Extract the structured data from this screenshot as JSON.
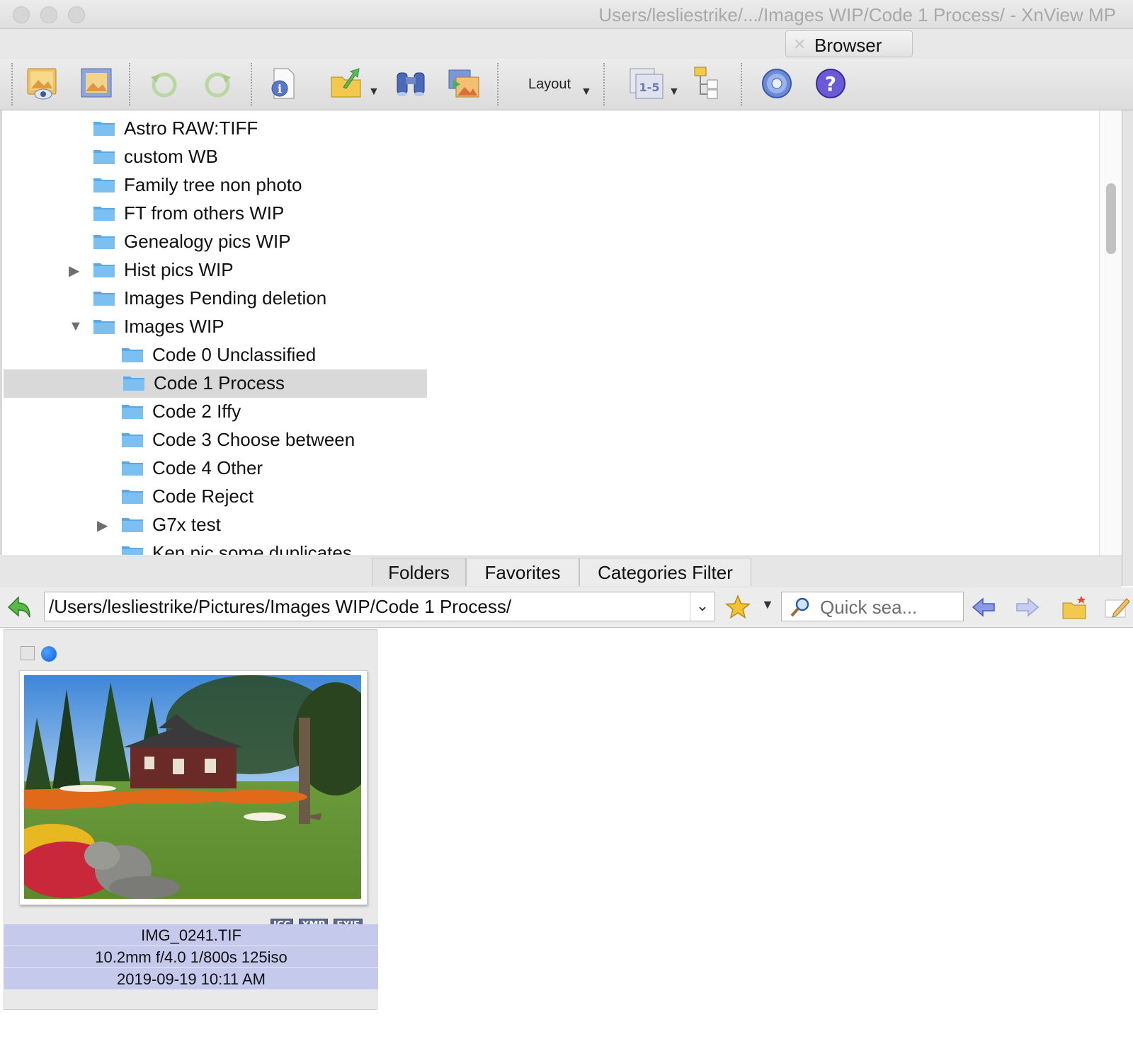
{
  "window": {
    "title": "Users/lesliestrike/.../Images WIP/Code 1 Process/ - XnView MP"
  },
  "tabs": {
    "browser_label": "Browser",
    "close_glyph": "✕"
  },
  "toolbar": {
    "layout_label": "Layout",
    "pages_label": "1-5",
    "icons": [
      "view-image-icon",
      "fullscreen-icon",
      "rotate-left-icon",
      "rotate-right-icon",
      "info-icon",
      "export-icon",
      "search-binoculars-icon",
      "convert-icon",
      "layout-dropdown",
      "batch-rename-icon",
      "compare-icon",
      "settings-gear-icon",
      "help-icon"
    ]
  },
  "tree": {
    "items": [
      {
        "label": "Astro RAW:TIFF",
        "level": 1,
        "expander": ""
      },
      {
        "label": "custom WB",
        "level": 1,
        "expander": ""
      },
      {
        "label": "Family tree non photo",
        "level": 1,
        "expander": ""
      },
      {
        "label": "FT from others WIP",
        "level": 1,
        "expander": ""
      },
      {
        "label": "Genealogy pics WIP",
        "level": 1,
        "expander": ""
      },
      {
        "label": "Hist pics WIP",
        "level": 1,
        "expander": "collapsed"
      },
      {
        "label": "Images Pending deletion",
        "level": 1,
        "expander": ""
      },
      {
        "label": "Images WIP",
        "level": 1,
        "expander": "expanded"
      },
      {
        "label": "Code 0 Unclassified",
        "level": 2,
        "expander": ""
      },
      {
        "label": "Code 1 Process",
        "level": 2,
        "expander": "",
        "selected": true
      },
      {
        "label": "Code 2 Iffy",
        "level": 2,
        "expander": ""
      },
      {
        "label": "Code 3 Choose between",
        "level": 2,
        "expander": ""
      },
      {
        "label": "Code 4 Other",
        "level": 2,
        "expander": ""
      },
      {
        "label": "Code Reject",
        "level": 2,
        "expander": ""
      },
      {
        "label": "G7x test",
        "level": 2,
        "expander": "collapsed"
      },
      {
        "label": "Ken pic some duplicates",
        "level": 2,
        "expander": ""
      }
    ]
  },
  "pane_tabs": {
    "folders": "Folders",
    "favorites": "Favorites",
    "categories": "Categories Filter"
  },
  "address": {
    "path": "/Users/lesliestrike/Pictures/Images WIP/Code 1 Process/",
    "quick_search_placeholder": "Quick sea..."
  },
  "thumbnail": {
    "filename": "IMG_0241.TIF",
    "exposure": "10.2mm f/4.0 1/800s 125iso",
    "date": "2019-09-19 10:11 AM",
    "badges": [
      "ICC",
      "XMP",
      "EXIF"
    ],
    "label_color": "#0a5fd8"
  },
  "colors": {
    "selection_bg": "#d9d9d9",
    "info_bg": "#c5c9ec",
    "folder_blue": "#6fb8ee"
  }
}
